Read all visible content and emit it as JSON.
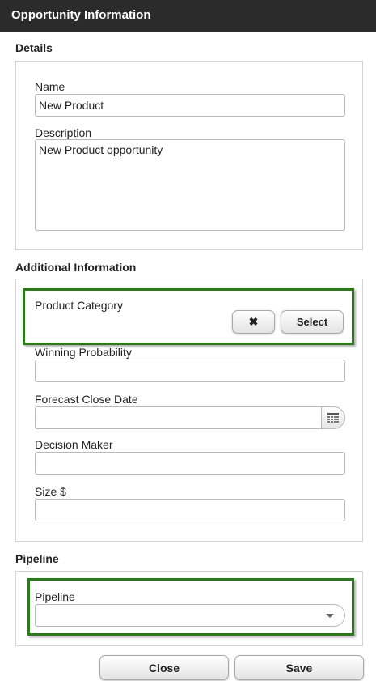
{
  "window": {
    "title": "Opportunity Information"
  },
  "details": {
    "heading": "Details",
    "name_label": "Name",
    "name_value": "New Product",
    "description_label": "Description",
    "description_value": "New Product opportunity"
  },
  "additional": {
    "heading": "Additional Information",
    "product_category_label": "Product Category",
    "clear_icon": "✖",
    "select_label": "Select",
    "winning_probability_label": "Winning Probability",
    "winning_probability_value": "",
    "forecast_close_date_label": "Forecast Close Date",
    "forecast_close_date_value": "",
    "decision_maker_label": "Decision Maker",
    "decision_maker_value": "",
    "size_label": "Size $",
    "size_value": ""
  },
  "pipeline": {
    "heading": "Pipeline",
    "pipeline_label": "Pipeline",
    "pipeline_value": ""
  },
  "footer": {
    "close_label": "Close",
    "save_label": "Save"
  },
  "icons": {
    "clear": "close-icon",
    "calendar": "calendar-icon",
    "dropdown": "chevron-down-icon"
  },
  "colors": {
    "titlebar": "#2b2b2b",
    "highlight": "#2a7a1c"
  }
}
